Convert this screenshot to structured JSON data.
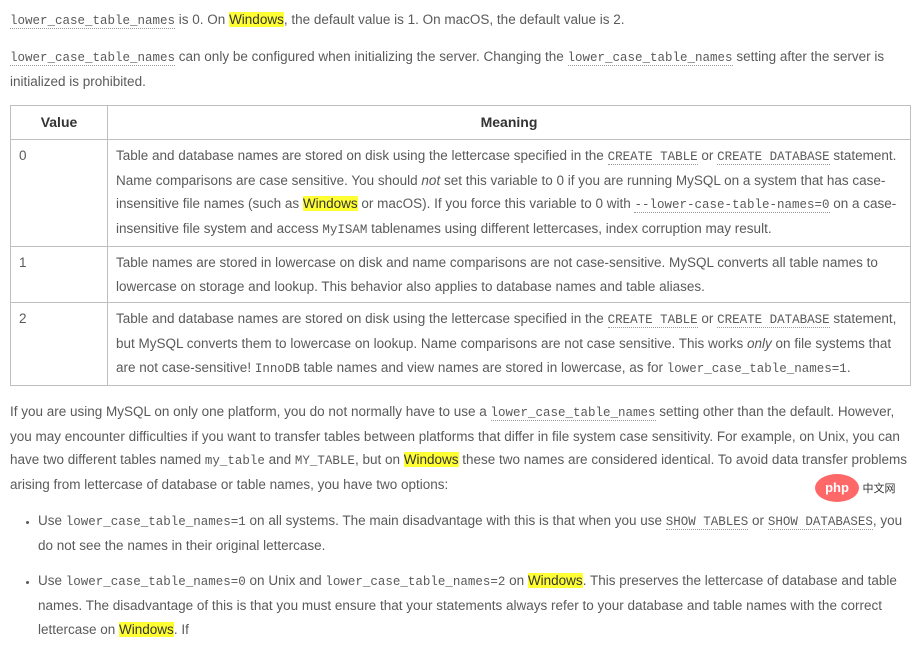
{
  "p1": {
    "a": "lower_case_table_names",
    "b": " is 0. On ",
    "c": "Windows",
    "d": ", the default value is 1. On macOS, the default value is 2."
  },
  "p2": {
    "a": "lower_case_table_names",
    "b": " can only be configured when initializing the server. Changing the ",
    "c": "lower_case_table_names",
    "d": " setting after the server is initialized is prohibited."
  },
  "table": {
    "h1": "Value",
    "h2": "Meaning",
    "r0": {
      "v": "0",
      "a": "Table and database names are stored on disk using the lettercase specified in the ",
      "b": "CREATE TABLE",
      "c": " or ",
      "d": "CREATE DATABASE",
      "e": " statement. Name comparisons are case sensitive. You should ",
      "f": "not",
      "g": " set this variable to 0 if you are running MySQL on a system that has case-insensitive file names (such as ",
      "h": "Windows",
      "i": " or macOS). If you force this variable to 0 with ",
      "j": "--lower-case-table-names=0",
      "k": " on a case-insensitive file system and access ",
      "l": "MyISAM",
      "m": " tablenames using different lettercases, index corruption may result."
    },
    "r1": {
      "v": "1",
      "a": "Table names are stored in lowercase on disk and name comparisons are not case-sensitive. MySQL converts all table names to lowercase on storage and lookup. This behavior also applies to database names and table aliases."
    },
    "r2": {
      "v": "2",
      "a": "Table and database names are stored on disk using the lettercase specified in the ",
      "b": "CREATE TABLE",
      "c": " or ",
      "d": "CREATE DATABASE",
      "e": " statement, but MySQL converts them to lowercase on lookup. Name comparisons are not case sensitive. This works ",
      "f": "only",
      "g": " on file systems that are not case-sensitive! ",
      "h": "InnoDB",
      "i": " table names and view names are stored in lowercase, as for ",
      "j": "lower_case_table_names=1",
      "k": "."
    }
  },
  "p3": {
    "a": "If you are using MySQL on only one platform, you do not normally have to use a ",
    "b": "lower_case_table_names",
    "c": " setting other than the default. However, you may encounter difficulties if you want to transfer tables between platforms that differ in file system case sensitivity. For example, on Unix, you can have two different tables named ",
    "d": "my_table",
    "e": " and ",
    "f": "MY_TABLE",
    "g": ", but on ",
    "h": "Windows",
    "i": " these two names are considered identical. To avoid data transfer problems arising from lettercase of database or table names, you have two options:"
  },
  "li1": {
    "a": "Use ",
    "b": "lower_case_table_names=1",
    "c": " on all systems. The main disadvantage with this is that when you use ",
    "d": "SHOW TABLES",
    "e": " or ",
    "f": "SHOW DATABASES",
    "g": ", you do not see the names in their original lettercase."
  },
  "li2": {
    "a": "Use ",
    "b": "lower_case_table_names=0",
    "c": " on Unix and ",
    "d": "lower_case_table_names=2",
    "e": " on ",
    "f": "Windows",
    "g": ". This preserves the lettercase of database and table names. The disadvantage of this is that you must ensure that your statements always refer to your database and table names with the correct lettercase on ",
    "h": "Windows",
    "i": ". If"
  },
  "logo": {
    "text1": "php",
    "text2": "中文网"
  }
}
